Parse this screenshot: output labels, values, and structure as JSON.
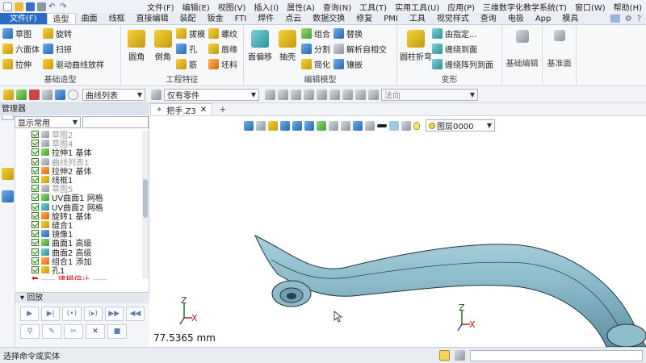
{
  "menubar": {
    "items": [
      "文件(F)",
      "编辑(E)",
      "视图(V)",
      "插入(I)",
      "属性(A)",
      "查询(N)",
      "工具(T)",
      "实用工具(U)",
      "应用(P)",
      "三维数字化教学系统(T)",
      "窗口(W)",
      "帮助(H)"
    ]
  },
  "tabs": [
    "文件(F)",
    "造型",
    "曲面",
    "线框",
    "直接编辑",
    "装配",
    "钣金",
    "FTI",
    "焊件",
    "点云",
    "数据交换",
    "修复",
    "PMI",
    "工具",
    "视觉样式",
    "查询",
    "电极",
    "App",
    "模具"
  ],
  "ribbon": {
    "basic": {
      "label": "基础造型",
      "items": [
        "草图",
        "旋转",
        "六面体",
        "扫掠",
        "拉伸",
        "驱动曲线放样"
      ]
    },
    "features": {
      "label": "工程特征",
      "round": "圆角",
      "chamfer": "倒角",
      "items": [
        "拔模",
        "螺纹",
        "孔",
        "唇缘",
        "筋",
        "坯料"
      ]
    },
    "edit": {
      "label": "编辑模型",
      "offset": "面偏移",
      "shell": "抽壳",
      "items": [
        "组合",
        "替换",
        "分割",
        "解析自相交",
        "简化",
        "镶嵌"
      ]
    },
    "deform": {
      "label": "变形",
      "cylinder": "圆柱折弯",
      "items": [
        "由指定...",
        "缠绕到面",
        "缠绕阵列到面"
      ]
    },
    "base_edit": {
      "label": "基础编辑"
    },
    "datum": {
      "label": "基准面"
    }
  },
  "toolbar": {
    "curve_list": "曲线列表",
    "filter": "仅有零件",
    "normal": "法向"
  },
  "panel": {
    "title": "管理器",
    "filter": "显示常用",
    "tree": [
      {
        "label": "草图2",
        "dim": true
      },
      {
        "label": "草图4",
        "dim": true
      },
      {
        "label": "拉伸1 基体",
        "dim": false
      },
      {
        "label": "曲线列表1",
        "dim": true
      },
      {
        "label": "拉伸2 基体",
        "dim": false
      },
      {
        "label": "线框1",
        "dim": false
      },
      {
        "label": "草图5",
        "dim": true
      },
      {
        "label": "UV曲面1 网格",
        "dim": false
      },
      {
        "label": "UV曲面2 网格",
        "dim": false
      },
      {
        "label": "旋转1 基体",
        "dim": false
      },
      {
        "label": "缝合1",
        "dim": false
      },
      {
        "label": "镜像1",
        "dim": false
      },
      {
        "label": "曲面1 高级",
        "dim": false
      },
      {
        "label": "曲面2 高级",
        "dim": false
      },
      {
        "label": "组合1 添加",
        "dim": false
      },
      {
        "label": "孔1",
        "dim": false
      }
    ],
    "stop": "----- 建模停止 -----",
    "playback": "回放"
  },
  "viewport": {
    "doc_tab": "把手.Z3",
    "layer": "图层0000",
    "measure": "77.5365 mm",
    "axis_z": "Z",
    "axis_x": "X"
  },
  "status": "选择命令或实体",
  "colors": {
    "file_tab": "#2b6cc4",
    "model": "#8cbecd",
    "model_edge": "#1f3440",
    "stop": "#c01818"
  }
}
